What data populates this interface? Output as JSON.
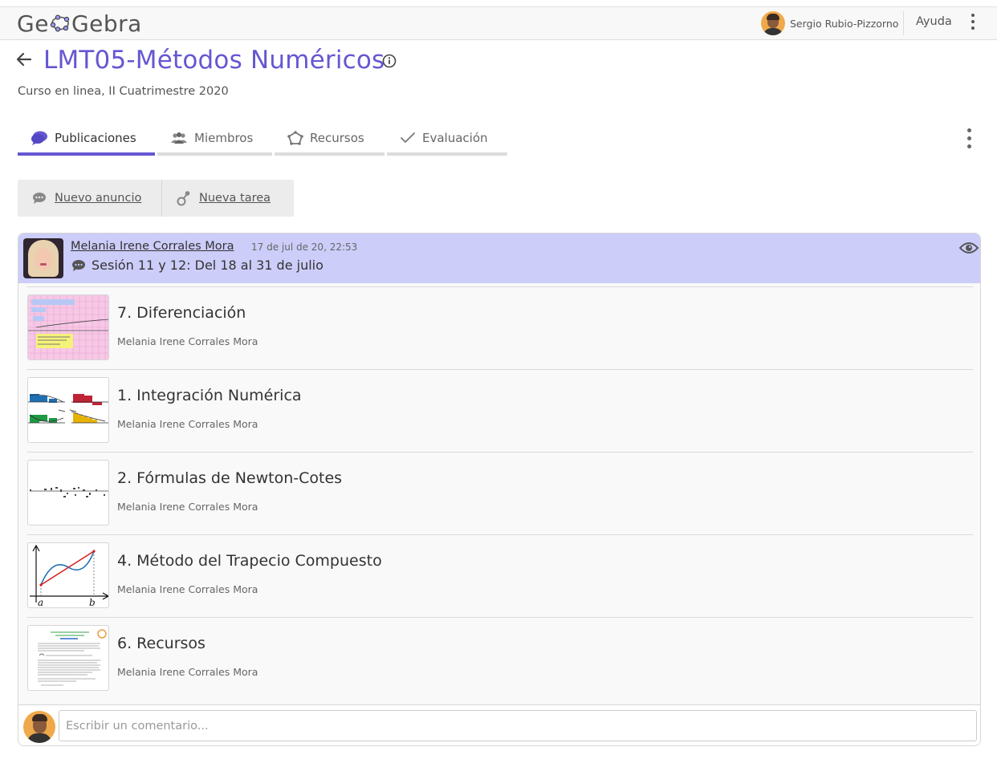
{
  "app": {
    "logo": {
      "left": "Ge",
      "right": "Gebra"
    },
    "user_name": "Sergio Rubio-Pizzorno",
    "help_label": "Ayuda"
  },
  "group": {
    "title": "LMT05-Métodos Numéricos",
    "subtitle": "Curso en linea, II Cuatrimestre 2020"
  },
  "tabs": [
    {
      "label": "Publicaciones",
      "active": true,
      "icon": "chat-icon"
    },
    {
      "label": "Miembros",
      "active": false,
      "icon": "members-icon"
    },
    {
      "label": "Recursos",
      "active": false,
      "icon": "resources-icon"
    },
    {
      "label": "Evaluación",
      "active": false,
      "icon": "check-icon"
    }
  ],
  "actions": {
    "new_announcement": "Nuevo anuncio",
    "new_task": "Nueva tarea"
  },
  "post": {
    "author": "Melania Irene Corrales Mora",
    "date": "17 de jul de 20, 22:53",
    "title": "Sesión 11 y 12: Del 18 al 31 de julio",
    "items": [
      {
        "title": "7. Diferenciación",
        "author": "Melania Irene Corrales Mora"
      },
      {
        "title": "1. Integración Numérica",
        "author": "Melania Irene Corrales Mora"
      },
      {
        "title": "2. Fórmulas de Newton-Cotes",
        "author": "Melania Irene Corrales Mora"
      },
      {
        "title": "4. Método del Trapecio Compuesto",
        "author": "Melania Irene Corrales Mora",
        "thumb_labels": {
          "a": "a",
          "b": "b"
        }
      },
      {
        "title": "6. Recursos",
        "author": "Melania Irene Corrales Mora"
      }
    ]
  },
  "comment": {
    "placeholder": "Escribir un comentario..."
  },
  "colors": {
    "accent": "#6557d2",
    "post_header": "#cdcdfa"
  }
}
